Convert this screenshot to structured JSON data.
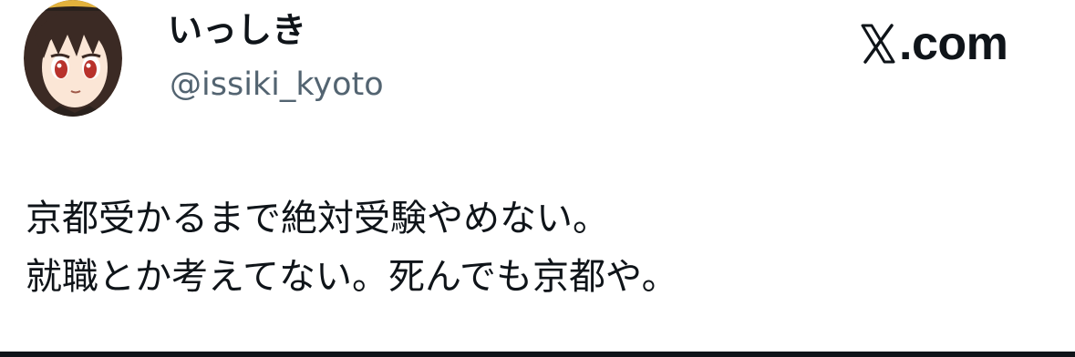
{
  "author": {
    "display_name": "いっしき",
    "handle": "@issiki_kyoto",
    "avatar_icon": "anime-character-avatar"
  },
  "brand": {
    "text": ".com",
    "logo_icon": "x-logo-icon"
  },
  "tweet": {
    "lines": [
      "京都受かるまで絶対受験やめない。",
      "就職とか考えてない。死んでも京都や。"
    ]
  },
  "colors": {
    "text_primary": "#0f1419",
    "text_secondary": "#536471",
    "background": "#ffffff"
  }
}
